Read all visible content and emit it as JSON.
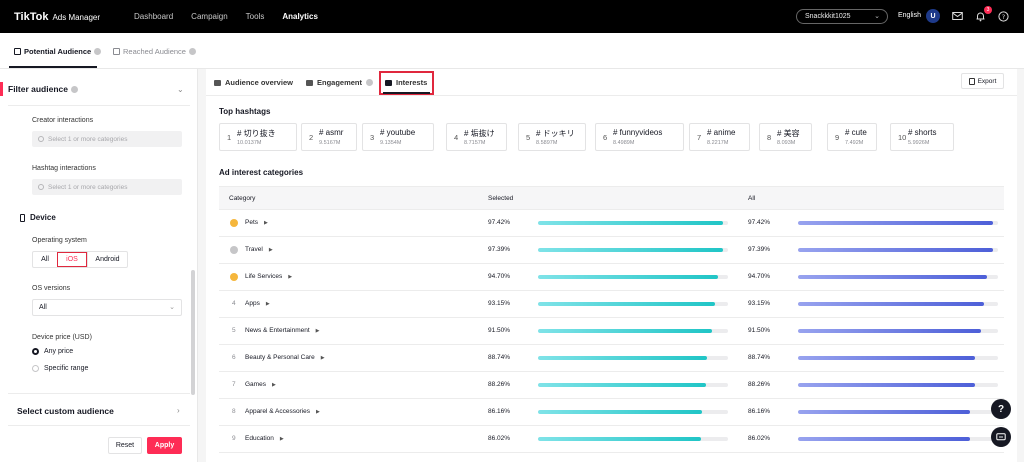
{
  "topbar": {
    "logo": "TikTok",
    "logo_sub": "Ads Manager",
    "nav": [
      "Dashboard",
      "Campaign",
      "Tools",
      "Analytics"
    ],
    "active_nav": "Analytics",
    "account": "Snackkkit1025",
    "language": "English",
    "avatar_initial": "U",
    "notification_count": "3",
    "icons": [
      "mail-icon",
      "bell-icon",
      "help-icon"
    ]
  },
  "page_tabs": {
    "potential": "Potential Audience",
    "reached": "Reached Audience"
  },
  "sidebar": {
    "filter_title": "Filter audience",
    "creator_label": "Creator interactions",
    "creator_placeholder": "Select 1 or more categories",
    "hashtag_label": "Hashtag interactions",
    "hashtag_placeholder": "Select 1 or more categories",
    "device_title": "Device",
    "os_label": "Operating system",
    "os_options": [
      "All",
      "iOS",
      "Android"
    ],
    "os_selected": "iOS",
    "os_versions_label": "OS versions",
    "os_versions_value": "All",
    "price_label": "Device price (USD)",
    "price_options": [
      "Any price",
      "Specific range"
    ],
    "price_selected": "Any price",
    "custom_audience": "Select custom audience",
    "reset": "Reset",
    "apply": "Apply"
  },
  "main": {
    "tabs": [
      "Audience overview",
      "Engagement",
      "Interests"
    ],
    "active_tab": "Interests",
    "export": "Export",
    "hashtags_title": "Top hashtags",
    "hashtags": [
      {
        "rank": "1",
        "name": "# 切り抜き",
        "count": "10.0137M"
      },
      {
        "rank": "2",
        "name": "# asmr",
        "count": "9.5167M"
      },
      {
        "rank": "3",
        "name": "# youtube",
        "count": "9.1354M"
      },
      {
        "rank": "4",
        "name": "# 垢抜け",
        "count": "8.7157M"
      },
      {
        "rank": "5",
        "name": "# ドッキリ",
        "count": "8.5897M"
      },
      {
        "rank": "6",
        "name": "# funnyvideos",
        "count": "8.4989M"
      },
      {
        "rank": "7",
        "name": "# anime",
        "count": "8.2217M"
      },
      {
        "rank": "8",
        "name": "# 美容",
        "count": "8.093M"
      },
      {
        "rank": "9",
        "name": "# cute",
        "count": "7.492M"
      },
      {
        "rank": "10",
        "name": "# shorts",
        "count": "5.9926M"
      }
    ],
    "interests_title": "Ad interest categories",
    "columns": {
      "category": "Category",
      "selected": "Selected",
      "all": "All"
    },
    "rows": [
      {
        "rank": "1",
        "category": "Pets",
        "selected": "97.42%",
        "all": "97.42%",
        "selected_value": 0.9742,
        "all_value": 0.9742
      },
      {
        "rank": "2",
        "category": "Travel",
        "selected": "97.39%",
        "all": "97.39%",
        "selected_value": 0.9739,
        "all_value": 0.9739
      },
      {
        "rank": "3",
        "category": "Life Services",
        "selected": "94.70%",
        "all": "94.70%",
        "selected_value": 0.947,
        "all_value": 0.947
      },
      {
        "rank": "4",
        "category": "Apps",
        "selected": "93.15%",
        "all": "93.15%",
        "selected_value": 0.9315,
        "all_value": 0.9315
      },
      {
        "rank": "5",
        "category": "News & Entertainment",
        "selected": "91.50%",
        "all": "91.50%",
        "selected_value": 0.915,
        "all_value": 0.915
      },
      {
        "rank": "6",
        "category": "Beauty & Personal Care",
        "selected": "88.74%",
        "all": "88.74%",
        "selected_value": 0.8874,
        "all_value": 0.8874
      },
      {
        "rank": "7",
        "category": "Games",
        "selected": "88.26%",
        "all": "88.26%",
        "selected_value": 0.8826,
        "all_value": 0.8826
      },
      {
        "rank": "8",
        "category": "Apparel & Accessories",
        "selected": "86.16%",
        "all": "86.16%",
        "selected_value": 0.8616,
        "all_value": 0.8616
      },
      {
        "rank": "9",
        "category": "Education",
        "selected": "86.02%",
        "all": "86.02%",
        "selected_value": 0.8602,
        "all_value": 0.8602
      }
    ]
  },
  "colors": {
    "accent": "#fe2c55",
    "selected_bar": "#20c5c6",
    "all_bar": "#4d5fd8",
    "medal_gold": "#f5b63c",
    "medal_silver": "#c6c6c8"
  }
}
